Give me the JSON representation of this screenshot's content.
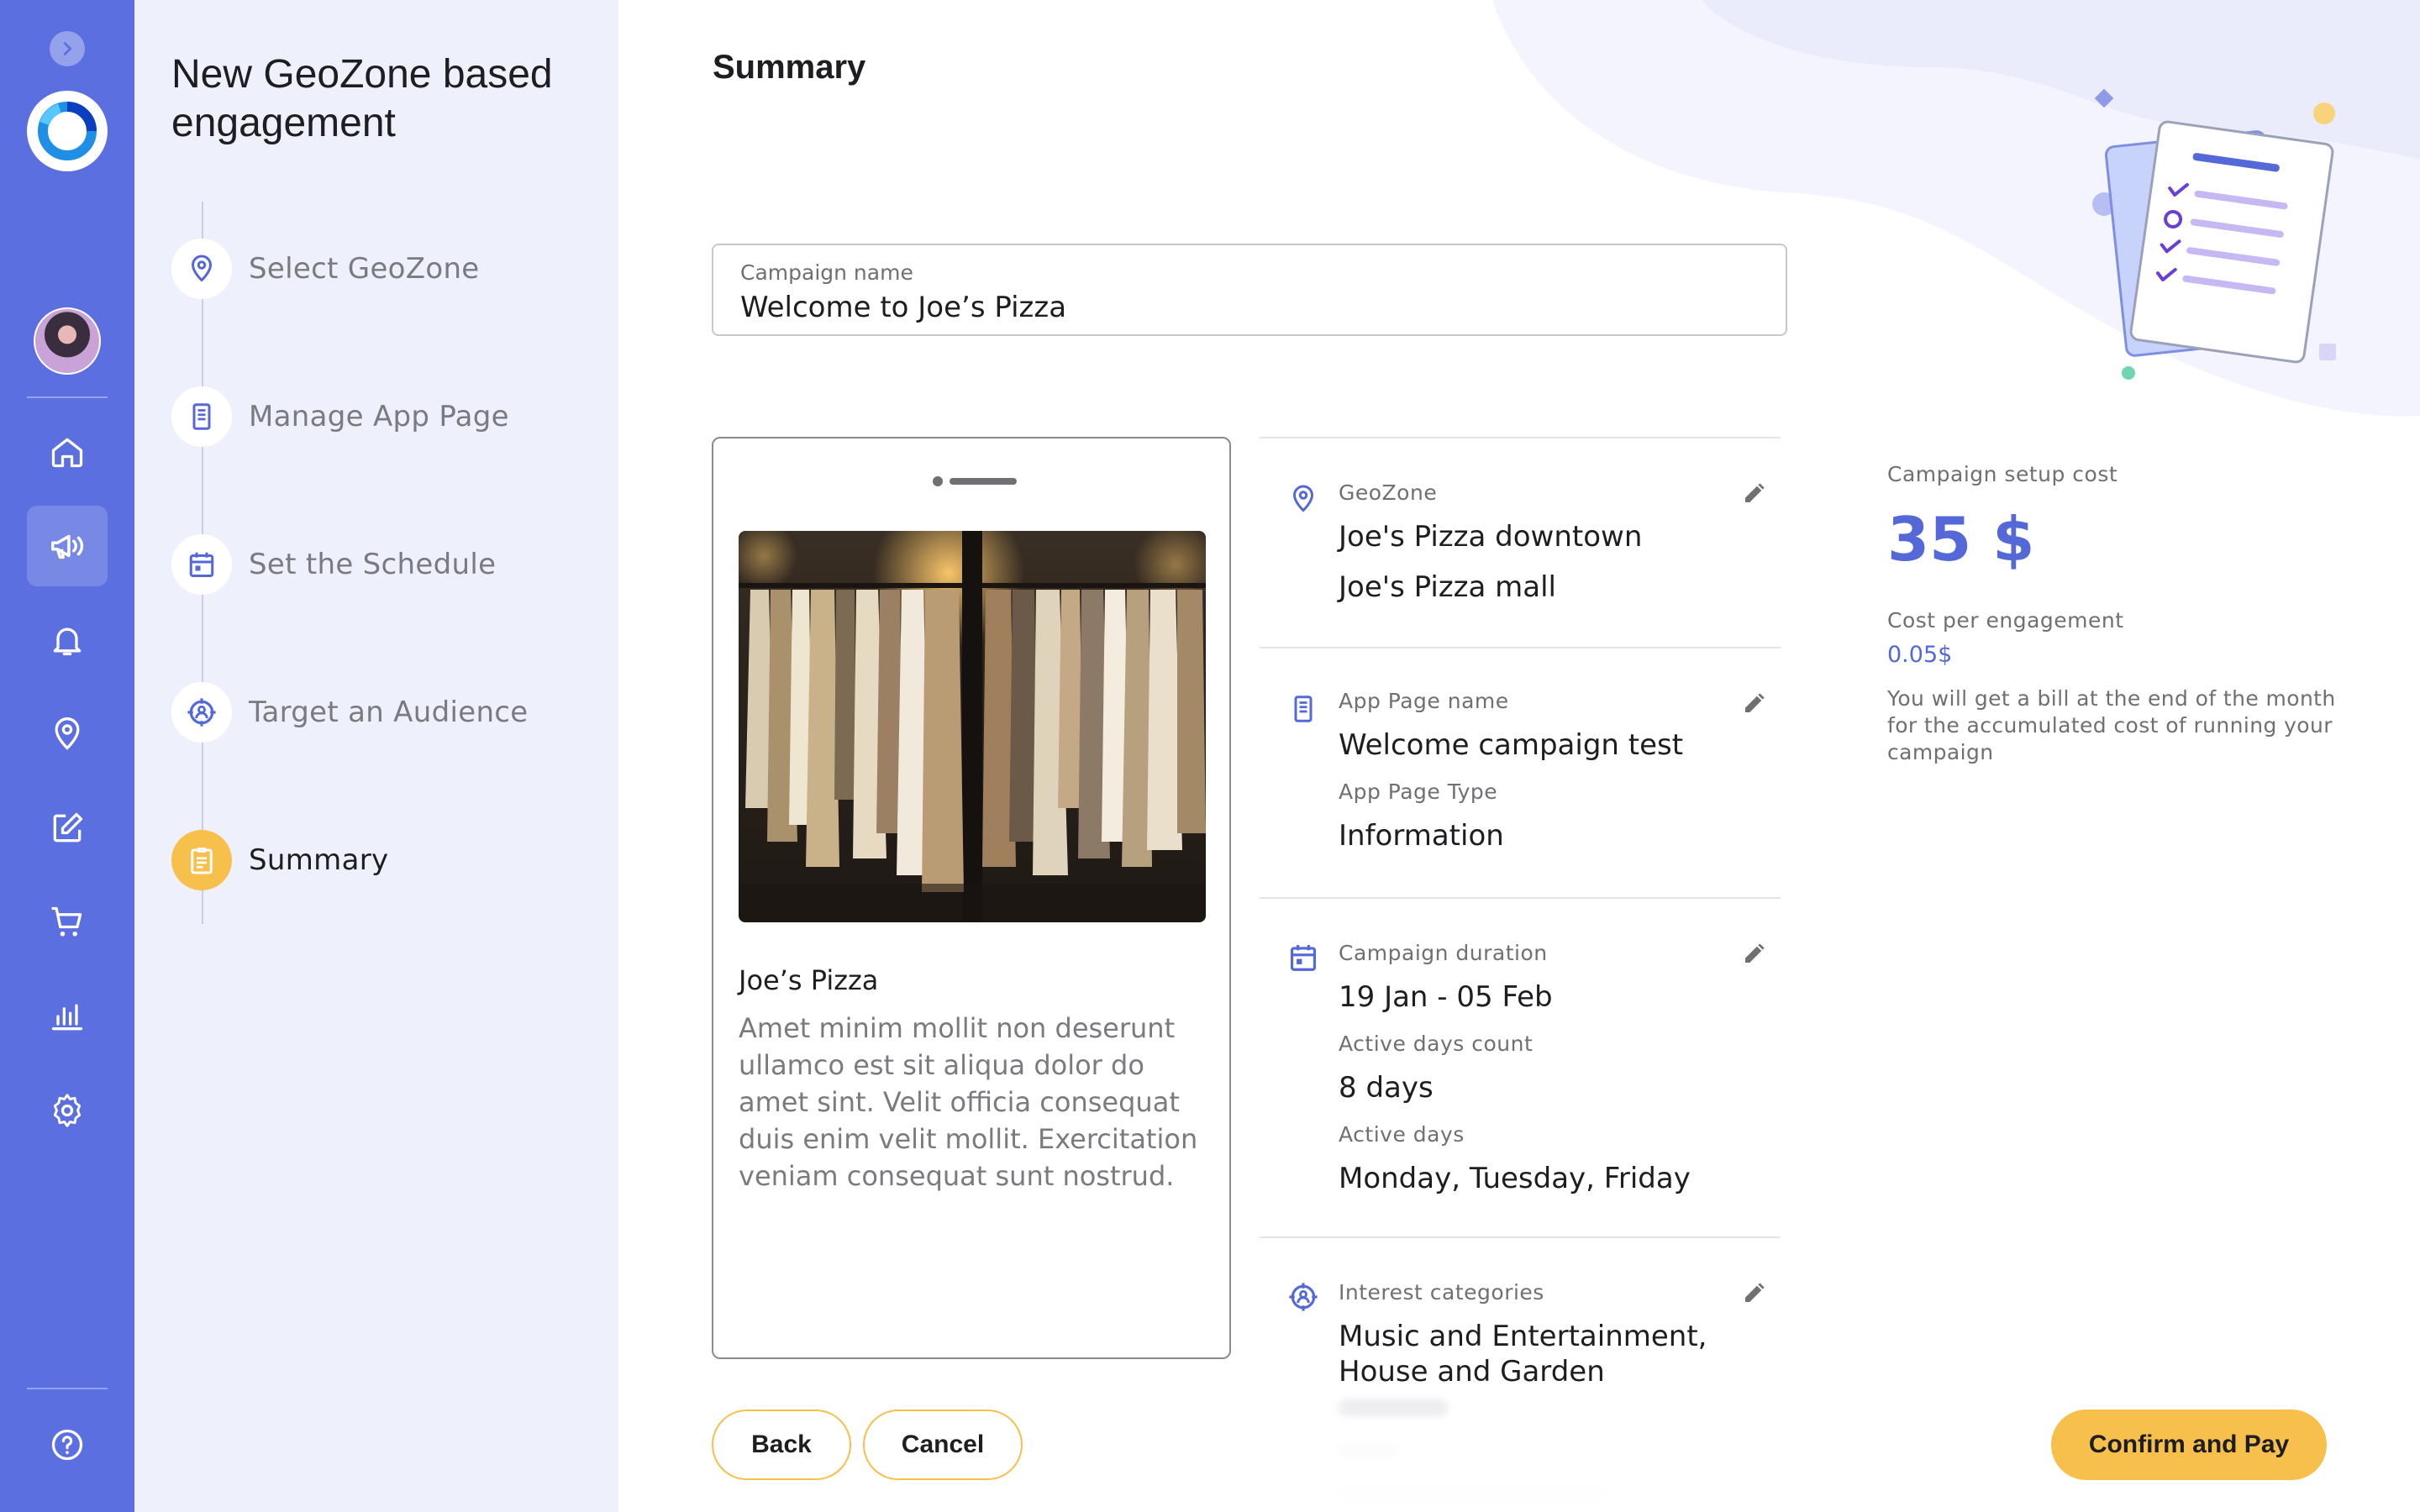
{
  "rail": {
    "nav": [
      "home",
      "campaigns",
      "notifications",
      "geozones",
      "edit",
      "shop",
      "analytics",
      "settings"
    ],
    "active": "campaigns",
    "colors": {
      "background": "#5b6fe0"
    }
  },
  "wizard": {
    "title": "New GeoZone based engagement",
    "steps": [
      {
        "label": "Select GeoZone",
        "icon": "location-pin-icon"
      },
      {
        "label": "Manage App Page",
        "icon": "mobile-page-icon"
      },
      {
        "label": "Set the Schedule",
        "icon": "calendar-icon"
      },
      {
        "label": "Target an Audience",
        "icon": "target-audience-icon"
      },
      {
        "label": "Summary",
        "icon": "clipboard-icon",
        "current": true
      }
    ]
  },
  "summary": {
    "title": "Summary",
    "campaign_name": {
      "label": "Campaign name",
      "value": "Welcome to Joe’s Pizza"
    },
    "preview": {
      "app_title": "Joe’s Pizza",
      "app_body": "Amet minim mollit non deserunt ullamco est sit aliqua dolor do amet sint. Velit officia consequat duis enim velit mollit. Exercitation veniam consequat sunt nostrud."
    },
    "details": {
      "geozone": {
        "label": "GeoZone",
        "values": [
          "Joe's Pizza downtown",
          "Joe's Pizza mall"
        ]
      },
      "app_page": {
        "name_label": "App Page name",
        "name_value": "Welcome campaign test",
        "type_label": "App Page Type",
        "type_value": "Information"
      },
      "schedule": {
        "duration_label": "Campaign duration",
        "duration_value": "19 Jan - 05 Feb",
        "count_label": "Active days count",
        "count_value": "8 days",
        "days_label": "Active days",
        "days_value": "Monday, Tuesday, Friday"
      },
      "audience": {
        "label": "Interest categories",
        "value": "Music and Entertainment, House and Garden"
      }
    },
    "cost": {
      "setup_label": "Campaign setup cost",
      "setup_value": "35 $",
      "per_engagement_label": "Cost per engagement",
      "per_engagement_value": "0.05$",
      "note": "You will get a bill at the end of the month for the accumulated cost of running your campaign"
    }
  },
  "actions": {
    "back": "Back",
    "cancel": "Cancel",
    "confirm": "Confirm and Pay"
  },
  "colors": {
    "accent": "#5468d8",
    "primary_button": "#f7bf4b",
    "steps_panel": "#eef0fb"
  }
}
